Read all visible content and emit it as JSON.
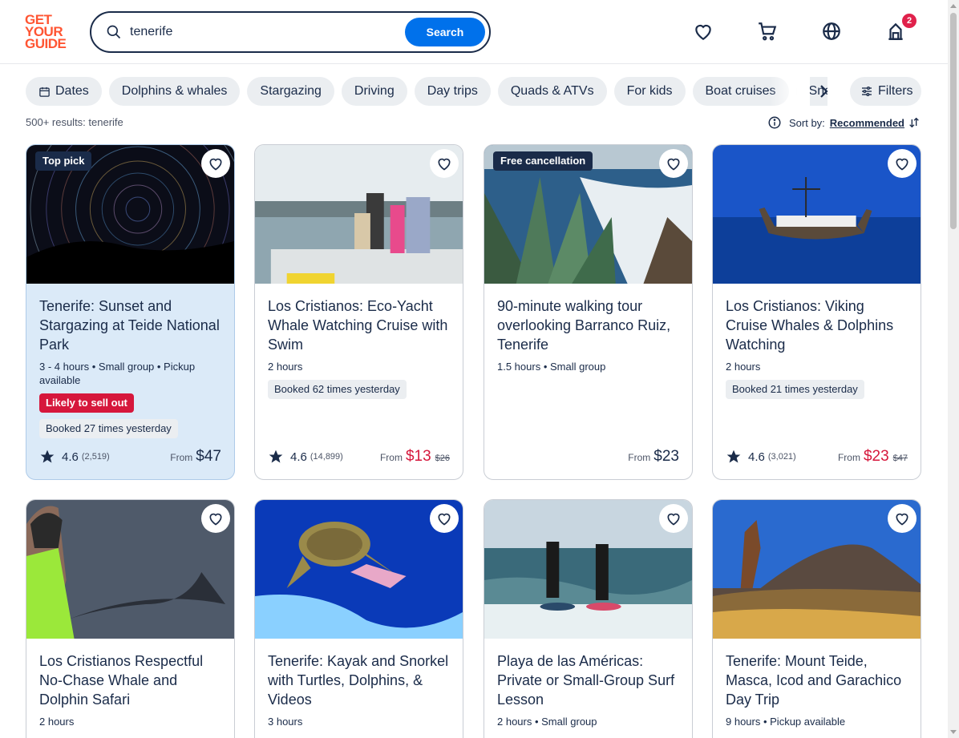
{
  "header": {
    "logo_lines": [
      "GET",
      "YOUR",
      "GUIDE"
    ],
    "search_value": "tenerife",
    "search_button": "Search",
    "cart_badge": "2"
  },
  "chips": [
    {
      "label": "Dates",
      "icon": "calendar-icon"
    },
    {
      "label": "Dolphins & whales"
    },
    {
      "label": "Stargazing"
    },
    {
      "label": "Driving"
    },
    {
      "label": "Day trips"
    },
    {
      "label": "Quads & ATVs"
    },
    {
      "label": "For kids"
    },
    {
      "label": "Boat cruises"
    },
    {
      "label": "Snorkeling"
    }
  ],
  "filters_label": "Filters",
  "results_text": "500+ results: tenerife",
  "sort": {
    "label": "Sort by:",
    "value": "Recommended"
  },
  "cards": [
    {
      "title": "Tenerife: Sunset and Stargazing at Teide National Park",
      "tag": "Top pick",
      "meta": "3 - 4 hours • Small group • Pickup available",
      "sell_out": "Likely to sell out",
      "booked": "Booked 27 times yesterday",
      "rating": "4.6",
      "reviews": "(2,519)",
      "from": "From",
      "price": "$47",
      "old_price": ""
    },
    {
      "title": "Los Cristianos: Eco-Yacht Whale Watching Cruise with Swim",
      "tag": "",
      "meta": "2 hours",
      "sell_out": "",
      "booked": "Booked 62 times yesterday",
      "rating": "4.6",
      "reviews": "(14,899)",
      "from": "From",
      "price": "$13",
      "old_price": "$26"
    },
    {
      "title": "90-minute walking tour overlooking Barranco Ruiz, Tenerife",
      "tag": "Free cancellation",
      "meta": "1.5 hours • Small group",
      "sell_out": "",
      "booked": "",
      "rating": "",
      "reviews": "",
      "from": "From",
      "price": "$23",
      "old_price": ""
    },
    {
      "title": "Los Cristianos: Viking Cruise Whales & Dolphins Watching",
      "tag": "",
      "meta": "2 hours",
      "sell_out": "",
      "booked": "Booked 21 times yesterday",
      "rating": "4.6",
      "reviews": "(3,021)",
      "from": "From",
      "price": "$23",
      "old_price": "$47"
    },
    {
      "title": "Los Cristianos Respectful No-Chase Whale and Dolphin Safari",
      "tag": "",
      "meta": "2 hours",
      "sell_out": "",
      "booked": "",
      "rating": "",
      "reviews": "",
      "from": "",
      "price": "",
      "old_price": ""
    },
    {
      "title": "Tenerife: Kayak and Snorkel with Turtles, Dolphins, & Videos",
      "tag": "",
      "meta": "3 hours",
      "sell_out": "",
      "booked": "",
      "rating": "",
      "reviews": "",
      "from": "",
      "price": "",
      "old_price": ""
    },
    {
      "title": "Playa de las Américas: Private or Small-Group Surf Lesson",
      "tag": "",
      "meta": "2 hours • Small group",
      "sell_out": "",
      "booked": "",
      "rating": "",
      "reviews": "",
      "from": "",
      "price": "",
      "old_price": ""
    },
    {
      "title": "Tenerife: Mount Teide, Masca, Icod and Garachico Day Trip",
      "tag": "",
      "meta": "9 hours • Pickup available",
      "sell_out": "",
      "booked": "",
      "rating": "",
      "reviews": "",
      "from": "",
      "price": "",
      "old_price": ""
    }
  ],
  "colors": {
    "brand": "#ff5533",
    "accent": "#0071eb",
    "sale": "#d6173c",
    "text": "#1a2b49"
  }
}
